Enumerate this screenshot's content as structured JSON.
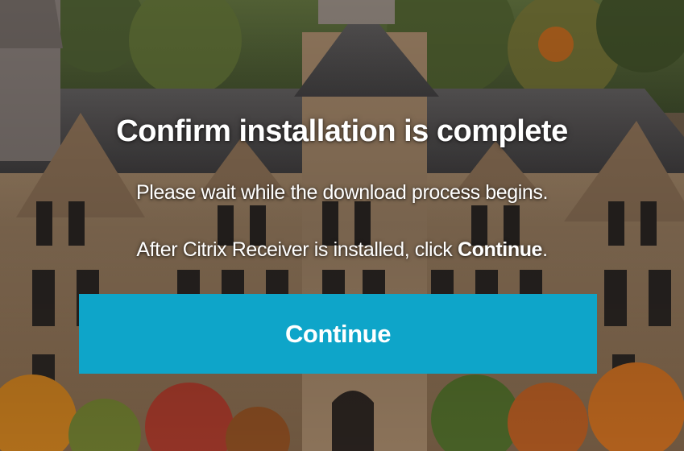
{
  "dialog": {
    "title": "Confirm installation is complete",
    "message_1": "Please wait while the download process begins.",
    "message_2_prefix": "After Citrix Receiver is installed, click ",
    "message_2_emphasis": "Continue",
    "message_2_suffix": ".",
    "continue_label": "Continue"
  },
  "colors": {
    "button": "#0ea5c9",
    "text": "#ffffff"
  }
}
